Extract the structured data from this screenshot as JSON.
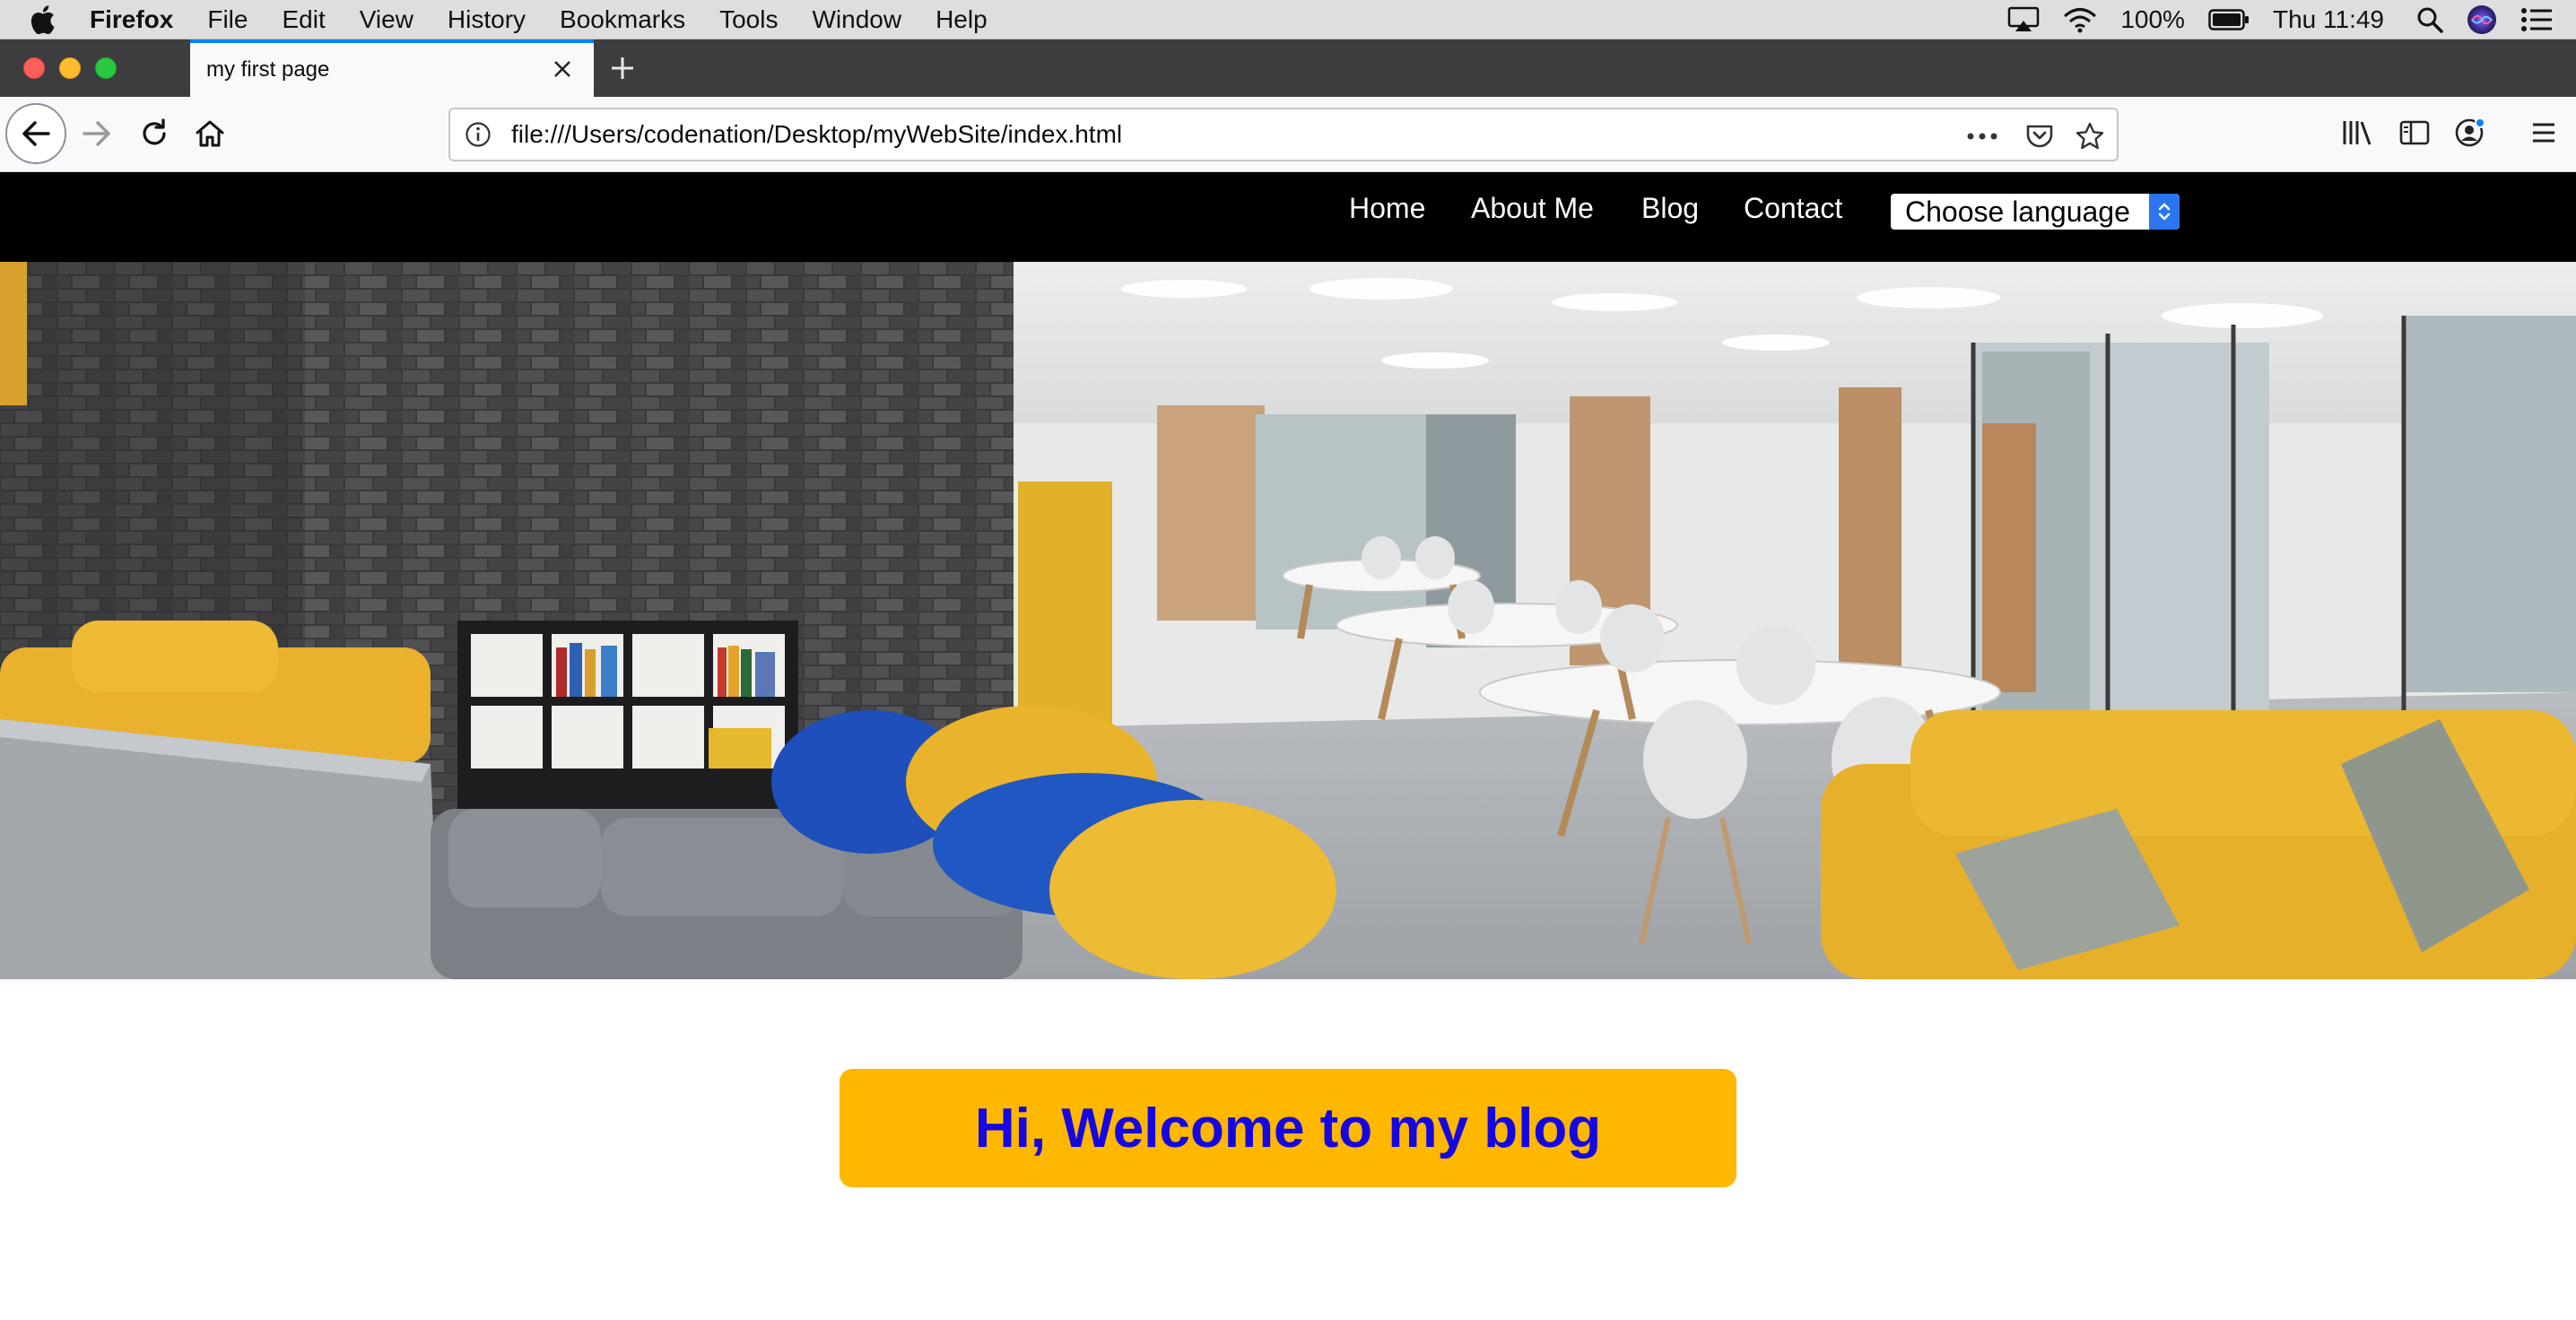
{
  "menubar": {
    "app_name": "Firefox",
    "items": [
      "File",
      "Edit",
      "View",
      "History",
      "Bookmarks",
      "Tools",
      "Window",
      "Help"
    ],
    "battery": "100%",
    "clock": "Thu 11:49"
  },
  "browser": {
    "tab_title": "my first page",
    "url": "file:///Users/codenation/Desktop/myWebSite/index.html"
  },
  "site": {
    "nav": {
      "home": "Home",
      "about": "About Me",
      "blog": "Blog",
      "contact": "Contact"
    },
    "language_select": "Choose language",
    "welcome": "Hi, Welcome to my blog",
    "colors": {
      "nav_background": "#000000",
      "banner_background": "#ffb700",
      "banner_text": "#1606e0"
    }
  }
}
